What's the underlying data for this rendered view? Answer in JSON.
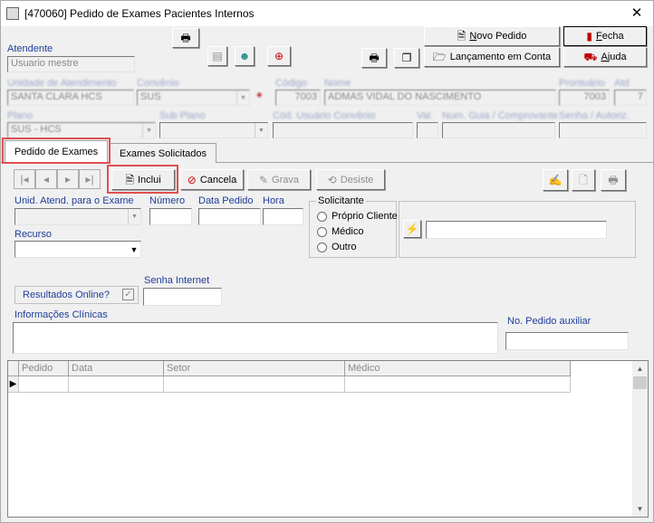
{
  "window": {
    "title": "[470060]  Pedido de Exames Pacientes Internos",
    "close": "✕"
  },
  "toolbar": {
    "novo_pedido": "Novo Pedido",
    "fecha": "Fecha",
    "lancamento": "Lançamento em Conta",
    "ajuda": "Ajuda"
  },
  "header": {
    "atendente_label": "Atendente",
    "atendente_value": "Usuario mestre",
    "unidade_label": "Unidade de Atendimento",
    "unidade_value": "SANTA CLARA HCS",
    "convenio_label": "Convênio",
    "convenio_value": "SUS",
    "codigo_label": "Código",
    "codigo_value": "7003",
    "nome_label": "Nome",
    "nome_value": "ADMAS VIDAL DO NASCIMENTO",
    "prontuario_label": "Prontuário",
    "prontuario_value": "7003",
    "atd_label": "Atd",
    "atd_value": "7",
    "plano_label": "Plano",
    "plano_value": "SUS - HCS",
    "subplano_label": "Sub Plano",
    "cod_usuario_label": "Cód. Usuário Convênio",
    "val_label": "Val.",
    "num_guia_label": "Num. Guia / Comprovante",
    "senha_autoriz_label": "Senha / Autoriz."
  },
  "tabs": [
    {
      "label": "Pedido de Exames"
    },
    {
      "label": "Exames Solicitados"
    }
  ],
  "actions": {
    "inclui": "Inclui",
    "cancela": "Cancela",
    "grava": "Grava",
    "desiste": "Desiste"
  },
  "form": {
    "unid_label": "Unid. Atend. para o Exame",
    "numero_label": "Número",
    "data_pedido_label": "Data Pedido",
    "hora_label": "Hora",
    "solicitante_label": "Solicitante",
    "radio_proprio": "Próprio Cliente",
    "radio_medico": "Médico",
    "radio_outro": "Outro",
    "recurso_label": "Recurso",
    "senha_internet_label": "Senha Internet",
    "resultados_online_label": "Resultados Online?",
    "info_clinicas_label": "Informações Clínicas",
    "no_pedido_aux_label": "No. Pedido auxiliar"
  },
  "grid": {
    "columns": [
      "Pedido",
      "Data",
      "Setor",
      "Médico"
    ]
  },
  "colors": {
    "highlight": "#e05050",
    "label_blue": "#1f3d99"
  }
}
